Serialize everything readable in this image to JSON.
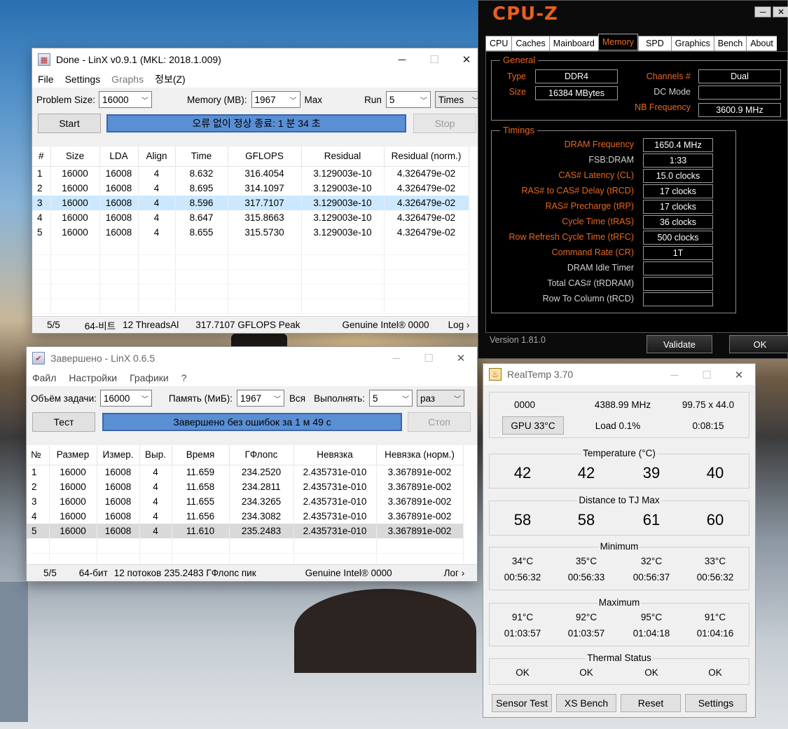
{
  "linx_en": {
    "title": "Done - LinX v0.9.1 (MKL: 2018.1.009)",
    "menu": [
      "File",
      "Settings",
      "Graphs",
      "정보(Z)"
    ],
    "problem_size_label": "Problem Size:",
    "problem_size_value": "16000",
    "memory_label": "Memory (MB):",
    "memory_value": "1967",
    "max_label": "Max",
    "run_label": "Run",
    "run_value": "5",
    "times_value": "Times",
    "start_label": "Start",
    "progress_text": "오류 없이 정상 종료: 1 분 34 초",
    "stop_label": "Stop",
    "columns": [
      "#",
      "Size",
      "LDA",
      "Align",
      "Time",
      "GFLOPS",
      "Residual",
      "Residual (norm.)"
    ],
    "rows": [
      [
        "1",
        "16000",
        "16008",
        "4",
        "8.632",
        "316.4054",
        "3.129003e-10",
        "4.326479e-02"
      ],
      [
        "2",
        "16000",
        "16008",
        "4",
        "8.695",
        "314.1097",
        "3.129003e-10",
        "4.326479e-02"
      ],
      [
        "3",
        "16000",
        "16008",
        "4",
        "8.596",
        "317.7107",
        "3.129003e-10",
        "4.326479e-02"
      ],
      [
        "4",
        "16000",
        "16008",
        "4",
        "8.647",
        "315.8663",
        "3.129003e-10",
        "4.326479e-02"
      ],
      [
        "5",
        "16000",
        "16008",
        "4",
        "8.655",
        "315.5730",
        "3.129003e-10",
        "4.326479e-02"
      ]
    ],
    "status": {
      "count": "5/5",
      "bits": "64-비트",
      "threads": "12 ThreadsAl",
      "peak": "317.7107 GFLOPS Peak",
      "cpu": "Genuine Intel® 0000",
      "log": "Log ›"
    }
  },
  "linx_ru": {
    "title": "Завершено - LinX 0.6.5",
    "menu": [
      "Файл",
      "Настройки",
      "Графики",
      "?"
    ],
    "problem_size_label": "Объём задачи:",
    "problem_size_value": "16000",
    "memory_label": "Память (МиБ):",
    "memory_value": "1967",
    "max_label": "Вся",
    "run_label": "Выполнять:",
    "run_value": "5",
    "times_value": "раз",
    "start_label": "Тест",
    "progress_text": "Завершено без ошибок за 1 м 49 с",
    "stop_label": "Стоп",
    "columns": [
      "№",
      "Размер",
      "Измер.",
      "Выр.",
      "Время",
      "ГФлопс",
      "Невязка",
      "Невязка (норм.)"
    ],
    "rows": [
      [
        "1",
        "16000",
        "16008",
        "4",
        "11.659",
        "234.2520",
        "2.435731e-010",
        "3.367891e-002"
      ],
      [
        "2",
        "16000",
        "16008",
        "4",
        "11.658",
        "234.2811",
        "2.435731e-010",
        "3.367891e-002"
      ],
      [
        "3",
        "16000",
        "16008",
        "4",
        "11.655",
        "234.3265",
        "2.435731e-010",
        "3.367891e-002"
      ],
      [
        "4",
        "16000",
        "16008",
        "4",
        "11.656",
        "234.3082",
        "2.435731e-010",
        "3.367891e-002"
      ],
      [
        "5",
        "16000",
        "16008",
        "4",
        "11.610",
        "235.2483",
        "2.435731e-010",
        "3.367891e-002"
      ]
    ],
    "status": {
      "count": "5/5",
      "bits": "64-бит",
      "threads": "12 потоков",
      "peak": "235.2483 ГФлопс пик",
      "cpu": "Genuine Intel® 0000",
      "log": "Лог ›"
    }
  },
  "cpuz": {
    "logo": "CPU-Z",
    "tabs": [
      "CPU",
      "Caches",
      "Mainboard",
      "Memory",
      "SPD",
      "Graphics",
      "Bench",
      "About"
    ],
    "general_legend": "General",
    "type_label": "Type",
    "type_value": "DDR4",
    "size_label": "Size",
    "size_value": "16384 MBytes",
    "channels_label": "Channels #",
    "channels_value": "Dual",
    "dc_mode_label": "DC Mode",
    "nb_freq_label": "NB Frequency",
    "nb_freq_value": "3600.9 MHz",
    "timings_legend": "Timings",
    "timings": [
      {
        "label": "DRAM Frequency",
        "value": "1650.4 MHz"
      },
      {
        "label": "FSB:DRAM",
        "value": "1:33"
      },
      {
        "label": "CAS# Latency (CL)",
        "value": "15.0 clocks"
      },
      {
        "label": "RAS# to CAS# Delay (tRCD)",
        "value": "17 clocks"
      },
      {
        "label": "RAS# Precharge (tRP)",
        "value": "17 clocks"
      },
      {
        "label": "Cycle Time (tRAS)",
        "value": "36 clocks"
      },
      {
        "label": "Row Refresh Cycle Time (tRFC)",
        "value": "500 clocks"
      },
      {
        "label": "Command Rate (CR)",
        "value": "1T"
      },
      {
        "label": "DRAM Idle Timer",
        "value": ""
      },
      {
        "label": "Total CAS# (tRDRAM)",
        "value": ""
      },
      {
        "label": "Row To Column (tRCD)",
        "value": ""
      }
    ],
    "version": "Version 1.81.0",
    "validate_label": "Validate",
    "ok_label": "OK"
  },
  "realtemp": {
    "title": "RealTemp 3.70",
    "top": {
      "vid": "0000",
      "freq": "4388.99 MHz",
      "mult": "99.75 x 44.0",
      "gpu": "GPU  33°C",
      "load": "Load  0.1%",
      "time": "0:08:15"
    },
    "temperature_legend": "Temperature (°C)",
    "temperatures": [
      "42",
      "42",
      "39",
      "40"
    ],
    "distance_legend": "Distance to TJ Max",
    "distances": [
      "58",
      "58",
      "61",
      "60"
    ],
    "minimum_legend": "Minimum",
    "minimum_temps": [
      "34°C",
      "35°C",
      "32°C",
      "33°C"
    ],
    "minimum_times": [
      "00:56:32",
      "00:56:33",
      "00:56:37",
      "00:56:32"
    ],
    "maximum_legend": "Maximum",
    "maximum_temps": [
      "91°C",
      "92°C",
      "95°C",
      "91°C"
    ],
    "maximum_times": [
      "01:03:57",
      "01:03:57",
      "01:04:18",
      "01:04:16"
    ],
    "thermal_legend": "Thermal Status",
    "thermal": [
      "OK",
      "OK",
      "OK",
      "OK"
    ],
    "buttons": [
      "Sensor Test",
      "XS Bench",
      "Reset",
      "Settings"
    ]
  },
  "colors": {
    "cpuz_orange": "#e8681e",
    "linx_progress": "#5a8fd4",
    "selection": "#cce8ff"
  }
}
